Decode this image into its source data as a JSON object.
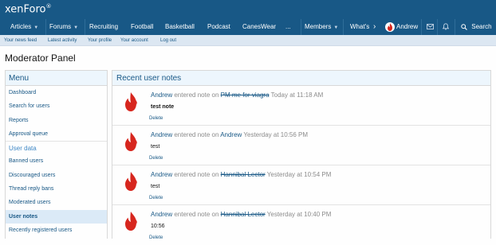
{
  "header": {
    "logo_text": "xenForo",
    "logo_mark": "®"
  },
  "nav": {
    "items": [
      {
        "label": "Articles",
        "has_caret": true
      },
      {
        "label": "Forums",
        "has_caret": true
      },
      {
        "label": "Recruiting",
        "has_caret": false
      },
      {
        "label": "Football",
        "has_caret": false
      },
      {
        "label": "Basketball",
        "has_caret": false
      },
      {
        "label": "Podcast",
        "has_caret": false
      },
      {
        "label": "CanesWear",
        "has_caret": false
      },
      {
        "label": "...",
        "has_caret": false
      },
      {
        "label": "Members",
        "has_caret": true
      },
      {
        "label": "What's",
        "has_caret": false
      }
    ],
    "user_label": "Andrew",
    "search_label": "Search",
    "icons": [
      "chevron-right-icon",
      "envelope-icon",
      "bell-icon",
      "search-icon"
    ]
  },
  "subnav": {
    "items": [
      "Your news feed",
      "Latest activity",
      "Your profile",
      "Your account",
      "Log out"
    ]
  },
  "page_title": "Moderator Panel",
  "sidebar": {
    "heading": "Menu",
    "items": [
      {
        "label": "Dashboard",
        "type": "link"
      },
      {
        "label": "Search for users",
        "type": "link"
      },
      {
        "label": "Reports",
        "type": "link"
      },
      {
        "label": "Approval queue",
        "type": "link"
      },
      {
        "label": "User data",
        "type": "section"
      },
      {
        "label": "Banned users",
        "type": "link"
      },
      {
        "label": "Discouraged users",
        "type": "link"
      },
      {
        "label": "Thread reply bans",
        "type": "link"
      },
      {
        "label": "Moderated users",
        "type": "link"
      },
      {
        "label": "User notes",
        "type": "active"
      },
      {
        "label": "Recently registered users",
        "type": "link"
      }
    ]
  },
  "main": {
    "heading": "Recent user notes",
    "notes": [
      {
        "author": "Andrew",
        "action": "entered note on",
        "target": "PM me for viagra",
        "target_struck": true,
        "time": "Today at 11:18 AM",
        "text": "test note",
        "text_bold": true,
        "delete_label": "Delete"
      },
      {
        "author": "Andrew",
        "action": "entered note on",
        "target": "Andrew",
        "target_struck": false,
        "time": "Yesterday at 10:56 PM",
        "text": "test",
        "text_bold": false,
        "delete_label": "Delete"
      },
      {
        "author": "Andrew",
        "action": "entered note on",
        "target": "Hannibal Lector",
        "target_struck": true,
        "time": "Yesterday at 10:54 PM",
        "text": "test",
        "text_bold": false,
        "delete_label": "Delete"
      },
      {
        "author": "Andrew",
        "action": "entered note on",
        "target": "Hannibal Lector",
        "target_struck": true,
        "time": "Yesterday at 10:40 PM",
        "text": "10:56",
        "text_bold": false,
        "delete_label": "Delete"
      }
    ]
  },
  "colors": {
    "header_bg": "#185886",
    "link": "#185886",
    "subnav_bg": "#dce7f2",
    "panel_head_bg": "#edf6fd",
    "active_item_bg": "#dbeaf7",
    "avatar_red": "#d7261e"
  }
}
